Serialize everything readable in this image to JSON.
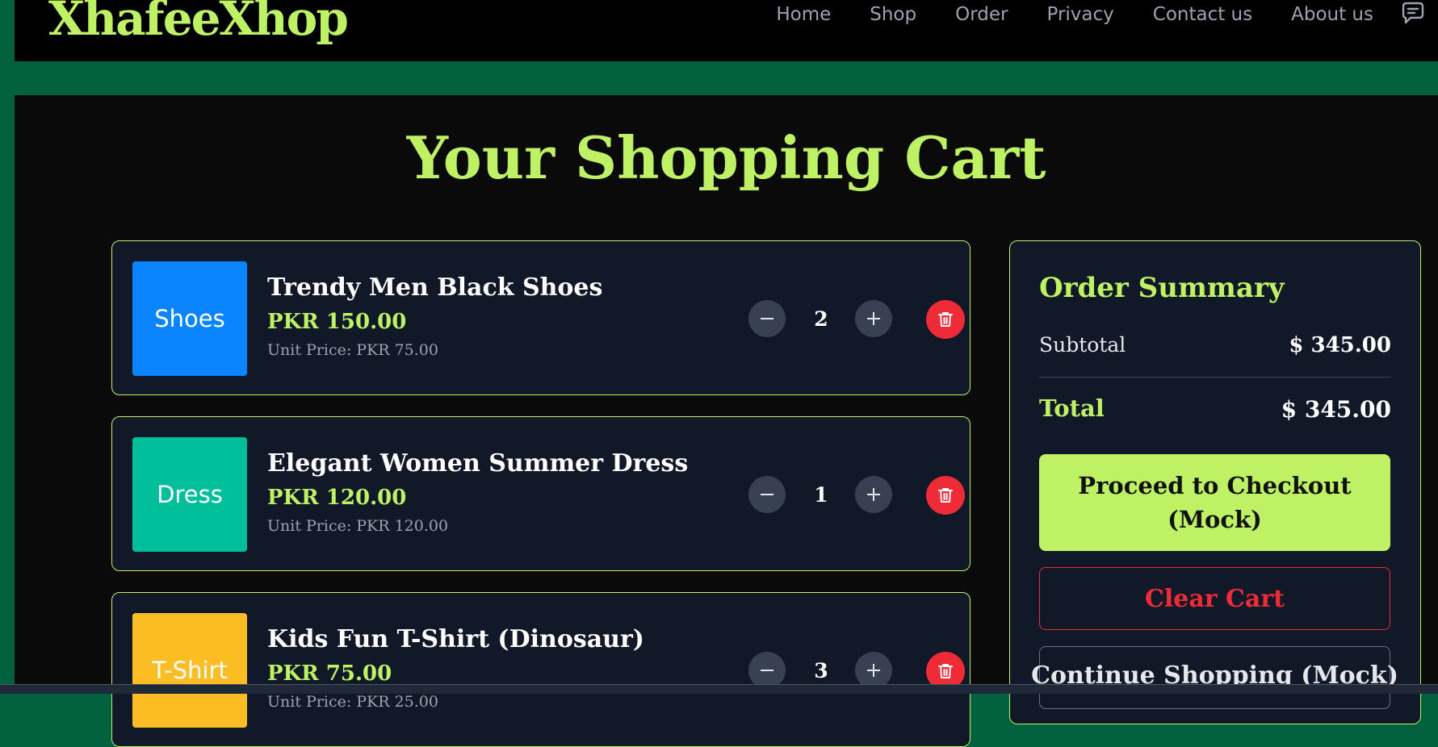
{
  "brand": {
    "name": "XhafeeXhop"
  },
  "nav": {
    "items": [
      "Home",
      "Shop",
      "Order",
      "Privacy",
      "Contact us",
      "About us"
    ],
    "chat_icon": "chat-icon"
  },
  "page": {
    "title": "Your Shopping Cart"
  },
  "cart": {
    "items": [
      {
        "thumb_label": "Shoes",
        "thumb_color": "#0a84ff",
        "name": "Trendy Men Black Shoes",
        "total": "PKR 150.00",
        "unit": "Unit Price: PKR 75.00",
        "qty": "2"
      },
      {
        "thumb_label": "Dress",
        "thumb_color": "#00bf9a",
        "name": "Elegant Women Summer Dress",
        "total": "PKR 120.00",
        "unit": "Unit Price: PKR 120.00",
        "qty": "1"
      },
      {
        "thumb_label": "T-Shirt",
        "thumb_color": "#fbbd23",
        "name": "Kids Fun T-Shirt (Dinosaur)",
        "total": "PKR 75.00",
        "unit": "Unit Price: PKR 25.00",
        "qty": "3"
      }
    ]
  },
  "summary": {
    "title": "Order Summary",
    "subtotal_label": "Subtotal",
    "subtotal_value": "$ 345.00",
    "total_label": "Total",
    "total_value": "$ 345.00",
    "checkout_label": "Proceed to Checkout (Mock)",
    "clear_label": "Clear Cart",
    "continue_label": "Continue Shopping (Mock)"
  },
  "colors": {
    "accent": "#bef264",
    "danger": "#ef2b37",
    "frame": "#02623f",
    "card": "#111827"
  }
}
